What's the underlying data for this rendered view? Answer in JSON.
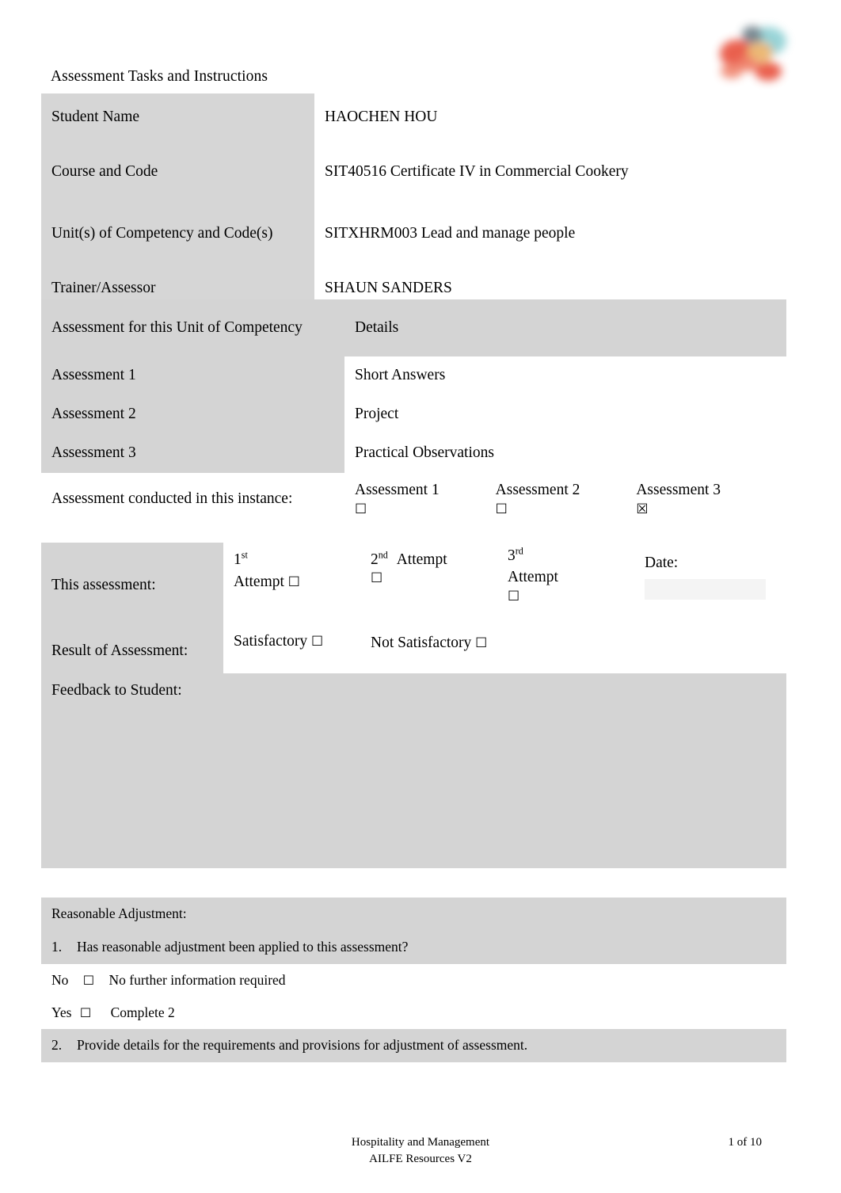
{
  "document": {
    "title": "Assessment Tasks and Instructions",
    "logo_alt": "organisation-logo"
  },
  "details_table": {
    "rows": [
      {
        "label": "Student Name",
        "value": "HAOCHEN HOU"
      },
      {
        "label": "Course and Code",
        "value": "SIT40516 Certificate IV in Commercial Cookery"
      },
      {
        "label": "Unit(s) of Competency and Code(s)",
        "value": "SITXHRM003 Lead and manage people"
      },
      {
        "label": "Trainer/Assessor",
        "value": "SHAUN SANDERS"
      }
    ]
  },
  "assessment_table": {
    "header_left": "Assessment for this Unit of Competency",
    "header_right": "Details",
    "rows": [
      {
        "label": "Assessment 1",
        "value": "Short Answers"
      },
      {
        "label": "Assessment 2",
        "value": "Project"
      },
      {
        "label": "Assessment 3",
        "value": "Practical Observations"
      }
    ],
    "conducted_label": "Assessment conducted in this instance:",
    "conducted_options": [
      {
        "label": "Assessment 1",
        "checked": false,
        "box": "☐"
      },
      {
        "label": "Assessment 2",
        "checked": false,
        "box": "☐"
      },
      {
        "label": "Assessment 3",
        "checked": true,
        "box": "☒"
      }
    ]
  },
  "attempt_table": {
    "this_assessment_label": "This assessment:",
    "attempt1_num": "1",
    "attempt1_ord": "st",
    "attempt1_word": "Attempt",
    "attempt1_box": "☐",
    "attempt2_num": "2",
    "attempt2_ord": "nd",
    "attempt2_word": "Attempt",
    "attempt2_box": "☐",
    "attempt3_num": "3",
    "attempt3_ord": "rd",
    "attempt3_word": "Attempt",
    "attempt3_box": "☐",
    "date_label": "Date:",
    "date_value": "",
    "result_label": "Result of Assessment:",
    "satisfactory_label": "Satisfactory",
    "satisfactory_box": "☐",
    "not_satisfactory_label": "Not Satisfactory",
    "not_satisfactory_box": "☐",
    "feedback_label": "Feedback to Student:",
    "feedback_value": ""
  },
  "adjustment_table": {
    "heading": "Reasonable Adjustment:",
    "q1_num": "1.",
    "q1_text": "Has reasonable adjustment been applied to this assessment?",
    "no_label": "No",
    "no_box": "☐",
    "no_text": "No further information required",
    "yes_label": "Yes",
    "yes_box": "☐",
    "yes_text": "Complete 2",
    "q2_num": "2.",
    "q2_text": "Provide details for the requirements and provisions for adjustment of assessment.",
    "answer_value": ""
  },
  "footer": {
    "line1": "Hospitality and Management",
    "line2": "AILFE Resources V2",
    "page": "1 of 10"
  },
  "colors": {
    "shade": "#d4d4d4",
    "shade_light": "#d6d6d6",
    "page_bg": "#ffffff",
    "text": "#000000",
    "logo_red": "#e8523f",
    "logo_teal": "#8fd0d4"
  }
}
